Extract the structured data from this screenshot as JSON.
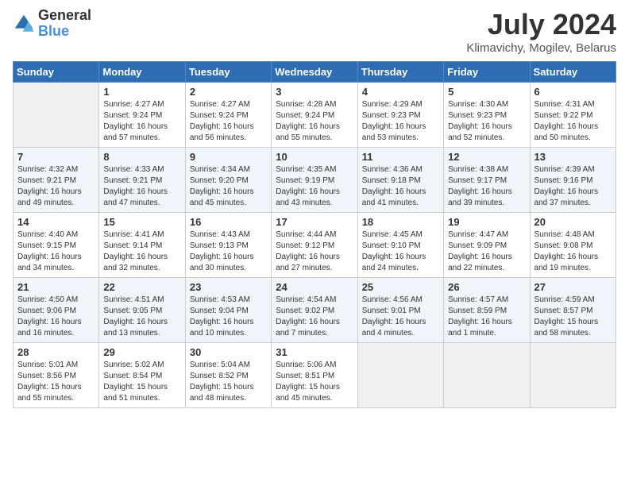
{
  "header": {
    "logo": {
      "line1": "General",
      "line2": "Blue"
    },
    "title": "July 2024",
    "subtitle": "Klimavichy, Mogilev, Belarus"
  },
  "weekdays": [
    "Sunday",
    "Monday",
    "Tuesday",
    "Wednesday",
    "Thursday",
    "Friday",
    "Saturday"
  ],
  "rows": [
    [
      {
        "day": "",
        "info": ""
      },
      {
        "day": "1",
        "info": "Sunrise: 4:27 AM\nSunset: 9:24 PM\nDaylight: 16 hours\nand 57 minutes."
      },
      {
        "day": "2",
        "info": "Sunrise: 4:27 AM\nSunset: 9:24 PM\nDaylight: 16 hours\nand 56 minutes."
      },
      {
        "day": "3",
        "info": "Sunrise: 4:28 AM\nSunset: 9:24 PM\nDaylight: 16 hours\nand 55 minutes."
      },
      {
        "day": "4",
        "info": "Sunrise: 4:29 AM\nSunset: 9:23 PM\nDaylight: 16 hours\nand 53 minutes."
      },
      {
        "day": "5",
        "info": "Sunrise: 4:30 AM\nSunset: 9:23 PM\nDaylight: 16 hours\nand 52 minutes."
      },
      {
        "day": "6",
        "info": "Sunrise: 4:31 AM\nSunset: 9:22 PM\nDaylight: 16 hours\nand 50 minutes."
      }
    ],
    [
      {
        "day": "7",
        "info": "Sunrise: 4:32 AM\nSunset: 9:21 PM\nDaylight: 16 hours\nand 49 minutes."
      },
      {
        "day": "8",
        "info": "Sunrise: 4:33 AM\nSunset: 9:21 PM\nDaylight: 16 hours\nand 47 minutes."
      },
      {
        "day": "9",
        "info": "Sunrise: 4:34 AM\nSunset: 9:20 PM\nDaylight: 16 hours\nand 45 minutes."
      },
      {
        "day": "10",
        "info": "Sunrise: 4:35 AM\nSunset: 9:19 PM\nDaylight: 16 hours\nand 43 minutes."
      },
      {
        "day": "11",
        "info": "Sunrise: 4:36 AM\nSunset: 9:18 PM\nDaylight: 16 hours\nand 41 minutes."
      },
      {
        "day": "12",
        "info": "Sunrise: 4:38 AM\nSunset: 9:17 PM\nDaylight: 16 hours\nand 39 minutes."
      },
      {
        "day": "13",
        "info": "Sunrise: 4:39 AM\nSunset: 9:16 PM\nDaylight: 16 hours\nand 37 minutes."
      }
    ],
    [
      {
        "day": "14",
        "info": "Sunrise: 4:40 AM\nSunset: 9:15 PM\nDaylight: 16 hours\nand 34 minutes."
      },
      {
        "day": "15",
        "info": "Sunrise: 4:41 AM\nSunset: 9:14 PM\nDaylight: 16 hours\nand 32 minutes."
      },
      {
        "day": "16",
        "info": "Sunrise: 4:43 AM\nSunset: 9:13 PM\nDaylight: 16 hours\nand 30 minutes."
      },
      {
        "day": "17",
        "info": "Sunrise: 4:44 AM\nSunset: 9:12 PM\nDaylight: 16 hours\nand 27 minutes."
      },
      {
        "day": "18",
        "info": "Sunrise: 4:45 AM\nSunset: 9:10 PM\nDaylight: 16 hours\nand 24 minutes."
      },
      {
        "day": "19",
        "info": "Sunrise: 4:47 AM\nSunset: 9:09 PM\nDaylight: 16 hours\nand 22 minutes."
      },
      {
        "day": "20",
        "info": "Sunrise: 4:48 AM\nSunset: 9:08 PM\nDaylight: 16 hours\nand 19 minutes."
      }
    ],
    [
      {
        "day": "21",
        "info": "Sunrise: 4:50 AM\nSunset: 9:06 PM\nDaylight: 16 hours\nand 16 minutes."
      },
      {
        "day": "22",
        "info": "Sunrise: 4:51 AM\nSunset: 9:05 PM\nDaylight: 16 hours\nand 13 minutes."
      },
      {
        "day": "23",
        "info": "Sunrise: 4:53 AM\nSunset: 9:04 PM\nDaylight: 16 hours\nand 10 minutes."
      },
      {
        "day": "24",
        "info": "Sunrise: 4:54 AM\nSunset: 9:02 PM\nDaylight: 16 hours\nand 7 minutes."
      },
      {
        "day": "25",
        "info": "Sunrise: 4:56 AM\nSunset: 9:01 PM\nDaylight: 16 hours\nand 4 minutes."
      },
      {
        "day": "26",
        "info": "Sunrise: 4:57 AM\nSunset: 8:59 PM\nDaylight: 16 hours\nand 1 minute."
      },
      {
        "day": "27",
        "info": "Sunrise: 4:59 AM\nSunset: 8:57 PM\nDaylight: 15 hours\nand 58 minutes."
      }
    ],
    [
      {
        "day": "28",
        "info": "Sunrise: 5:01 AM\nSunset: 8:56 PM\nDaylight: 15 hours\nand 55 minutes."
      },
      {
        "day": "29",
        "info": "Sunrise: 5:02 AM\nSunset: 8:54 PM\nDaylight: 15 hours\nand 51 minutes."
      },
      {
        "day": "30",
        "info": "Sunrise: 5:04 AM\nSunset: 8:52 PM\nDaylight: 15 hours\nand 48 minutes."
      },
      {
        "day": "31",
        "info": "Sunrise: 5:06 AM\nSunset: 8:51 PM\nDaylight: 15 hours\nand 45 minutes."
      },
      {
        "day": "",
        "info": ""
      },
      {
        "day": "",
        "info": ""
      },
      {
        "day": "",
        "info": ""
      }
    ]
  ]
}
